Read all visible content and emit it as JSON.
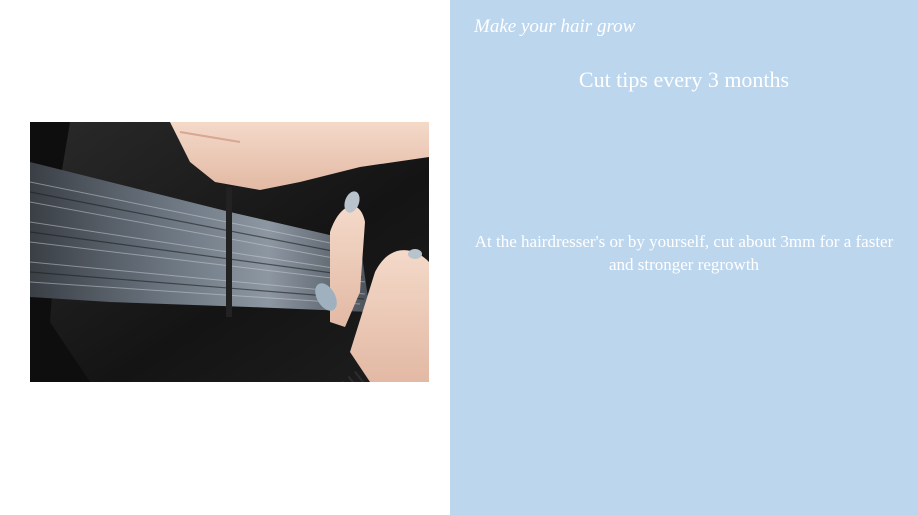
{
  "slide": {
    "eyebrow": "Make your hair grow",
    "title": "Cut tips every 3 months",
    "body": "At the hairdresser's or by yourself, cut about 3mm for a faster and stronger regrowth"
  },
  "photo": {
    "description_icon": "hair-cutting-photo"
  },
  "colors": {
    "panel_background": "#bcd6ee",
    "text": "#ffffff",
    "page_background": "#ffffff"
  }
}
